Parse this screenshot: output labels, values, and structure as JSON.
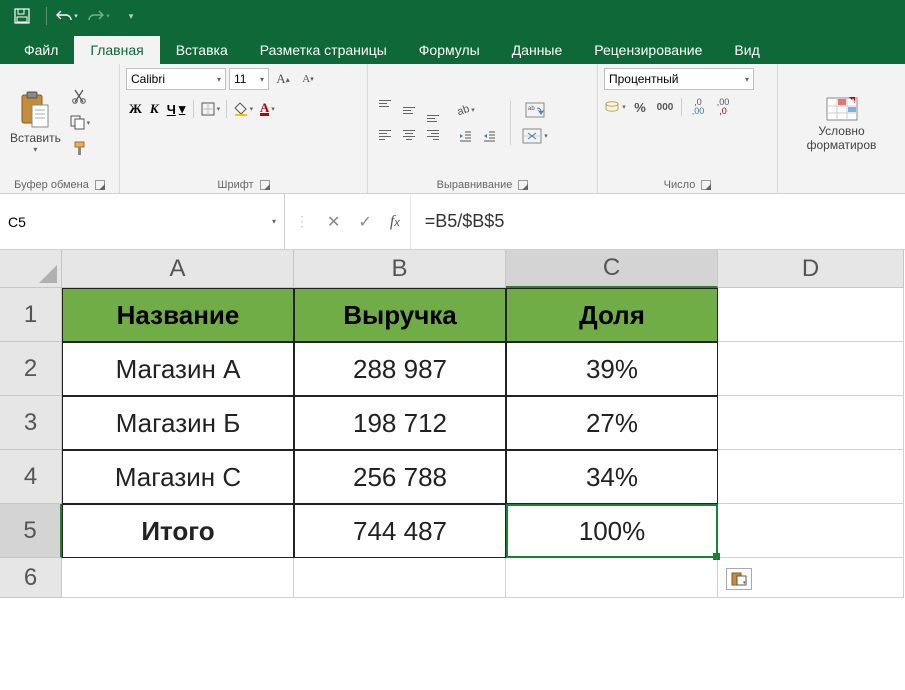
{
  "qat": {
    "undo_caret": "▾",
    "redo_caret": "▾"
  },
  "tabs": [
    "Файл",
    "Главная",
    "Вставка",
    "Разметка страницы",
    "Формулы",
    "Данные",
    "Рецензирование",
    "Вид"
  ],
  "active_tab_index": 1,
  "ribbon": {
    "clipboard": {
      "paste": "Вставить",
      "label": "Буфер обмена"
    },
    "font": {
      "name": "Calibri",
      "size": "11",
      "label": "Шрифт",
      "bold": "Ж",
      "italic": "К",
      "underline": "Ч"
    },
    "alignment": {
      "label": "Выравнивание"
    },
    "number": {
      "format": "Процентный",
      "label": "Число"
    },
    "cond": {
      "line1": "Условно",
      "line2": "форматиров"
    }
  },
  "namebox": "C5",
  "formula": "=B5/$B$5",
  "columns": [
    "A",
    "B",
    "C",
    "D"
  ],
  "rows": [
    "1",
    "2",
    "3",
    "4",
    "5",
    "6"
  ],
  "table": {
    "headers": [
      "Название",
      "Выручка",
      "Доля"
    ],
    "data": [
      [
        "Магазин А",
        "288 987",
        "39%"
      ],
      [
        "Магазин Б",
        "198 712",
        "27%"
      ],
      [
        "Магазин С",
        "256 788",
        "34%"
      ]
    ],
    "total": [
      "Итого",
      "744 487",
      "100%"
    ]
  }
}
